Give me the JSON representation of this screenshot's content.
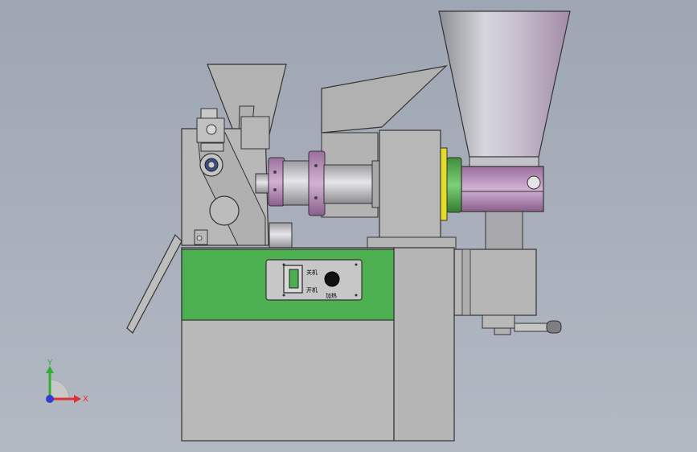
{
  "panel": {
    "label_poweron": "开机",
    "label_poweroff": "关机",
    "label_heat": "加热"
  },
  "triad": {
    "x_label": "X",
    "y_label": "Y"
  },
  "colors": {
    "background": "#a8afbb",
    "body": "#b8b8b8",
    "body_stroke": "#333333",
    "green_band": "#4caf50",
    "purple_ring": "#b48ab6",
    "green_ring": "#56ad52",
    "yellow_ring": "#e3dd2a",
    "axis_x": "#e03030",
    "axis_y": "#30b030",
    "axis_z": "#2d3fd0"
  }
}
